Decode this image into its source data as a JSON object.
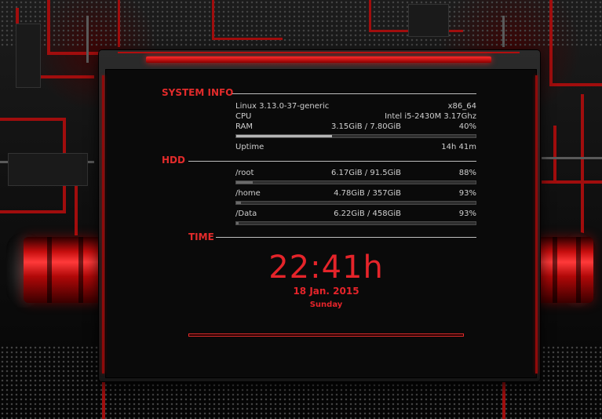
{
  "sections": {
    "system_info": "SYSTEM INFO",
    "hdd": "HDD",
    "time": "TIME"
  },
  "system": {
    "kernel": "Linux 3.13.0-37-generic",
    "arch": "x86_64",
    "cpu_label": "CPU",
    "cpu_value": "Intel i5-2430M 3.17Ghz",
    "ram_label": "RAM",
    "ram_value": "3.15GiB / 7.80GiB",
    "ram_percent": "40%",
    "ram_fraction": 0.4,
    "uptime_label": "Uptime",
    "uptime_value": "14h 41m"
  },
  "hdd": [
    {
      "mount": "/root",
      "usage": "6.17GiB / 91.5GiB",
      "percent": "88%",
      "fraction": 0.07
    },
    {
      "mount": "/home",
      "usage": "4.78GiB / 357GiB",
      "percent": "93%",
      "fraction": 0.02
    },
    {
      "mount": "/Data",
      "usage": "6.22GiB / 458GiB",
      "percent": "93%",
      "fraction": 0.01
    }
  ],
  "time": {
    "clock": "22:41h",
    "date": "18 Jan. 2015",
    "day": "Sunday"
  },
  "colors": {
    "accent": "#e22b2b",
    "text": "#cfcfcf",
    "panel": "#0a0a0a"
  }
}
